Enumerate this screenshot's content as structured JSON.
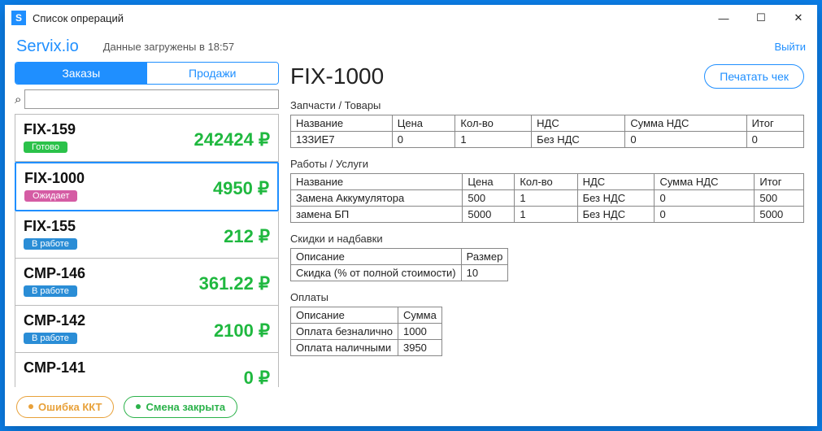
{
  "window": {
    "title": "Список опрераций",
    "icon_letter": "S"
  },
  "header": {
    "brand": "Servix.io",
    "status": "Данные загружены в 18:57",
    "logout": "Выйти"
  },
  "tabs": {
    "orders": "Заказы",
    "sales": "Продажи",
    "active": 0
  },
  "search": {
    "placeholder": ""
  },
  "orders": [
    {
      "id": "FIX-159",
      "status": "Готово",
      "status_kind": "ready",
      "price": "242424 ₽"
    },
    {
      "id": "FIX-1000",
      "status": "Ожидает",
      "status_kind": "wait",
      "price": "4950 ₽",
      "selected": true
    },
    {
      "id": "FIX-155",
      "status": "В работе",
      "status_kind": "work",
      "price": "212 ₽"
    },
    {
      "id": "CMP-146",
      "status": "В работе",
      "status_kind": "work",
      "price": "361.22 ₽"
    },
    {
      "id": "CMP-142",
      "status": "В работе",
      "status_kind": "work",
      "price": "2100 ₽"
    },
    {
      "id": "CMP-141",
      "status": "",
      "status_kind": "",
      "price": "0 ₽"
    }
  ],
  "detail": {
    "title": "FIX-1000",
    "print_label": "Печатать чек",
    "parts": {
      "heading": "Запчасти / Товары",
      "columns": [
        "Название",
        "Цена",
        "Кол-во",
        "НДС",
        "Сумма НДС",
        "Итог"
      ],
      "rows": [
        [
          "13ЗИЕ7",
          "0",
          "1",
          "Без НДС",
          "0",
          "0"
        ]
      ]
    },
    "services": {
      "heading": "Работы / Услуги",
      "columns": [
        "Название",
        "Цена",
        "Кол-во",
        "НДС",
        "Сумма НДС",
        "Итог"
      ],
      "rows": [
        [
          "Замена Аккумулятора",
          "500",
          "1",
          "Без НДС",
          "0",
          "500"
        ],
        [
          "замена БП",
          "5000",
          "1",
          "Без НДС",
          "0",
          "5000"
        ]
      ]
    },
    "discounts": {
      "heading": "Скидки и надбавки",
      "columns": [
        "Описание",
        "Размер"
      ],
      "rows": [
        [
          "Скидка (% от полной стоимости)",
          "10"
        ]
      ]
    },
    "payments": {
      "heading": "Оплаты",
      "columns": [
        "Описание",
        "Сумма"
      ],
      "rows": [
        [
          "Оплата безналично",
          "1000"
        ],
        [
          "Оплата наличными",
          "3950"
        ]
      ]
    }
  },
  "footer": {
    "error": "Ошибка ККТ",
    "shift": "Смена закрыта"
  }
}
